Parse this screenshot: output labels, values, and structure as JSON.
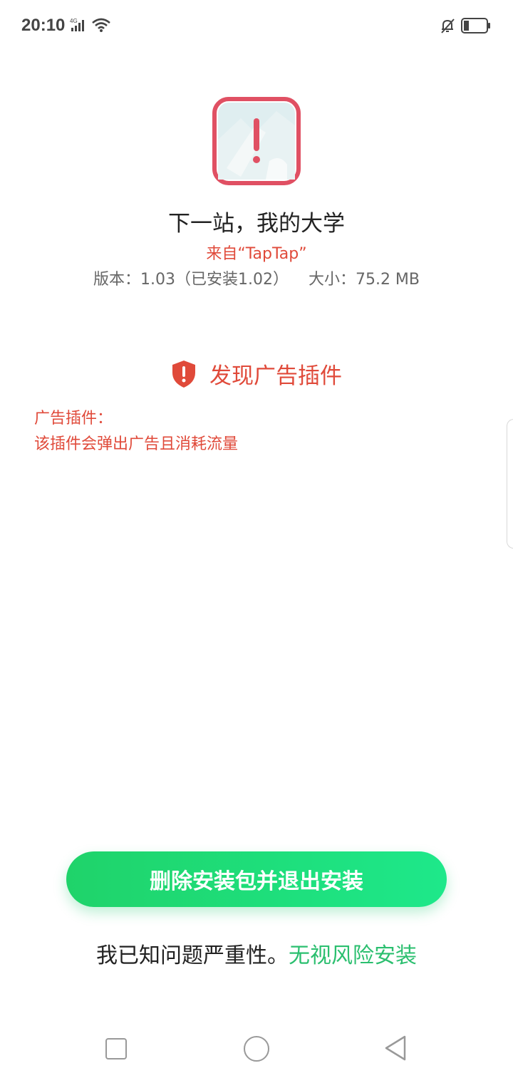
{
  "status_bar": {
    "time": "20:10",
    "network": "4G",
    "icons": [
      "signal-icon",
      "wifi-icon",
      "mute-icon",
      "battery-icon"
    ]
  },
  "app": {
    "name": "下一站，我的大学",
    "source": "来自“TapTap”",
    "version": "版本：1.03（已安装1.02）",
    "size": "大小：75.2 MB"
  },
  "warning": {
    "title": "发现广告插件",
    "detail_label": "广告插件：",
    "detail_text": "该插件会弹出广告且消耗流量"
  },
  "actions": {
    "primary_label": "删除安装包并退出安装",
    "risk_text": "我已知问题严重性。",
    "risk_link": "无视风险安装"
  },
  "colors": {
    "warning_red": "#e04a3a",
    "accent_green": "#1fd36a",
    "link_green": "#2bbf6f"
  }
}
